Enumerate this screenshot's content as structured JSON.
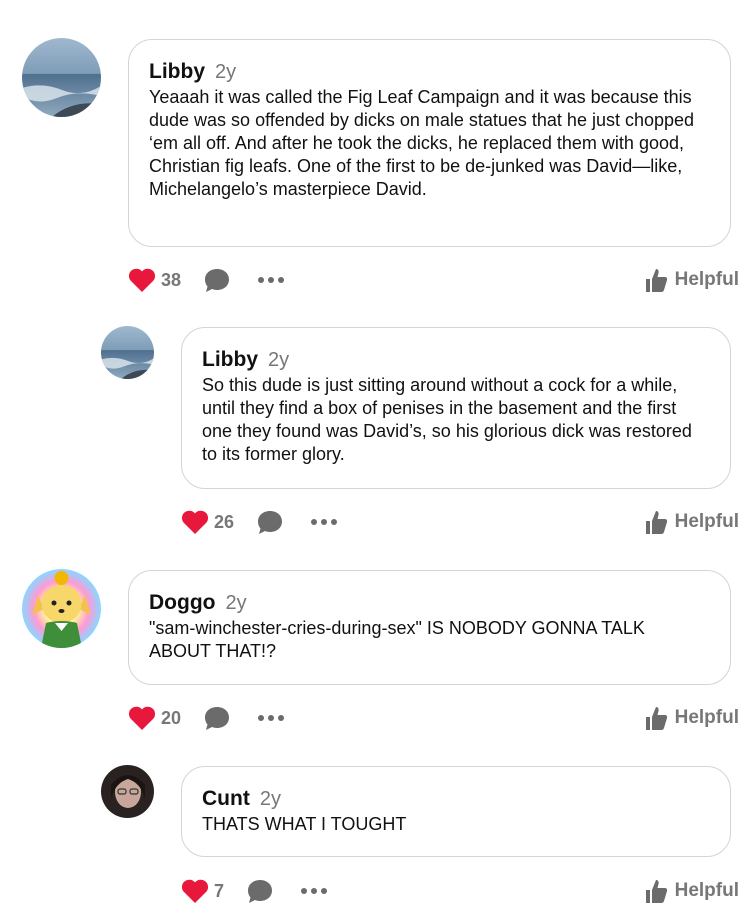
{
  "comments": [
    {
      "author": "Libby",
      "age": "2y",
      "text": "Yeaaah it was called the Fig Leaf Campaign and it was because this dude was so offended by dicks on male statues that he just chopped ‘em all off. And after he took the dicks, he replaced them with good, Christian fig leafs. One of the first to be de-junked was David—like, Michelangelo’s masterpiece David.",
      "likes": "38",
      "helpful_label": "Helpful",
      "avatar": "ocean-waves-photo"
    },
    {
      "author": "Libby",
      "age": "2y",
      "text": "So this dude is just sitting around without a cock for a while, until they find a box of penises in the basement and the first one they found was David’s, so his glorious dick was restored to its former glory.",
      "likes": "26",
      "helpful_label": "Helpful",
      "avatar": "ocean-waves-photo"
    },
    {
      "author": "Doggo",
      "age": "2y",
      "text": "\"sam-winchester-cries-during-sex\" IS NOBODY GONNA TALK ABOUT THAT!?",
      "likes": "20",
      "helpful_label": "Helpful",
      "avatar": "isabelle-character-rainbow"
    },
    {
      "author": "Cunt",
      "age": "2y",
      "text": "THATS WHAT I TOUGHT",
      "likes": "7",
      "helpful_label": "Helpful",
      "avatar": "person-dark-photo"
    }
  ],
  "colors": {
    "like_heart": "#e8173c",
    "icon_gray": "#6b6b6b",
    "bubble_border": "#d4d4d4"
  }
}
